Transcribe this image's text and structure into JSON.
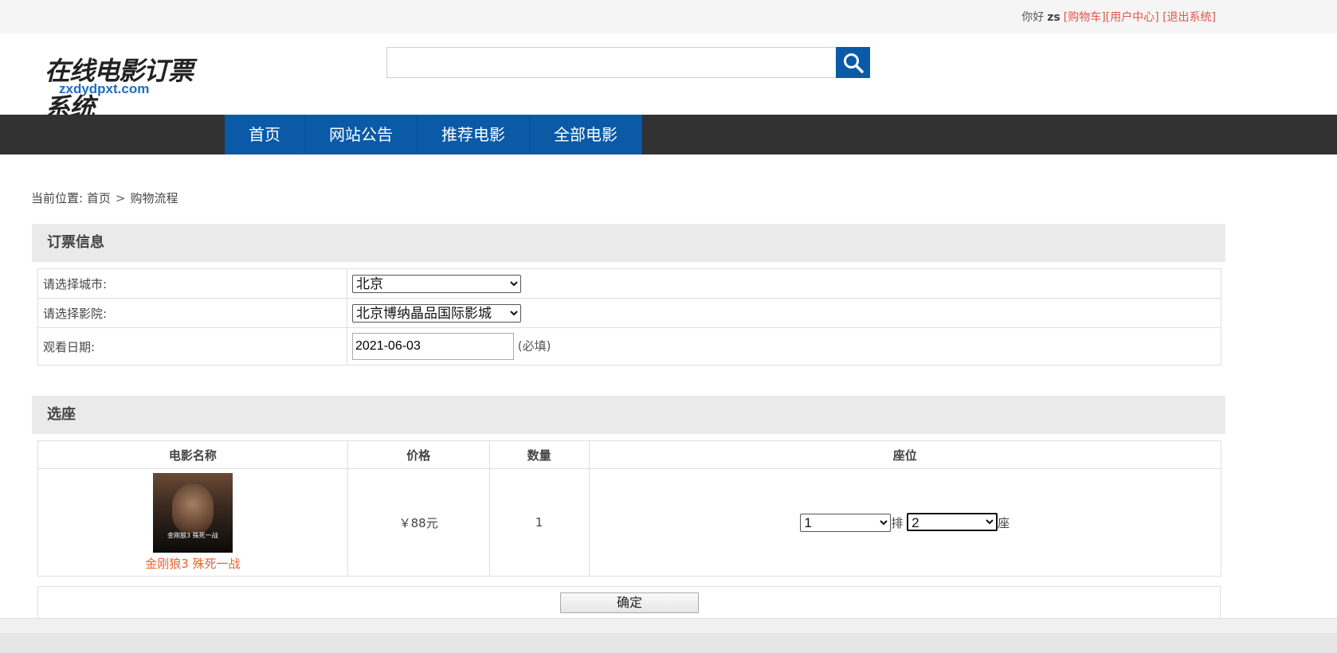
{
  "topbar": {
    "greeting": "你好",
    "username": "zs",
    "cart_link": "[购物车]",
    "user_center_link": "[用户中心]",
    "logout_link": "[退出系统]"
  },
  "logo": {
    "calligraphy": "在线电影订票系统",
    "domain": "zxdydpxt.com"
  },
  "search": {
    "value": "",
    "icon": "search-icon"
  },
  "nav": {
    "items": [
      "首页",
      "网站公告",
      "推荐电影",
      "全部电影"
    ]
  },
  "breadcrumb": {
    "prefix": "当前位置:",
    "home": "首页",
    "separator": ">",
    "current": "购物流程"
  },
  "booking": {
    "title": "订票信息",
    "city_label": "请选择城市:",
    "city_value": "北京",
    "cinema_label": "请选择影院:",
    "cinema_value": "北京博纳晶品国际影城",
    "date_label": "观看日期:",
    "date_value": "2021-06-03",
    "date_hint": "(必填)"
  },
  "seat": {
    "title": "选座",
    "headers": [
      "电影名称",
      "价格",
      "数量",
      "座位"
    ],
    "movie_name": "金刚狼3 殊死一战",
    "price": "￥88元",
    "quantity": "1",
    "row_value": "1",
    "row_unit": "排",
    "seat_value": "2",
    "seat_unit": "座"
  },
  "confirm_label": "确定",
  "colors": {
    "nav_blue": "#0a5aa8",
    "nav_bar": "#323232",
    "link_red": "#e5534b",
    "movie_link": "#e8642b"
  }
}
